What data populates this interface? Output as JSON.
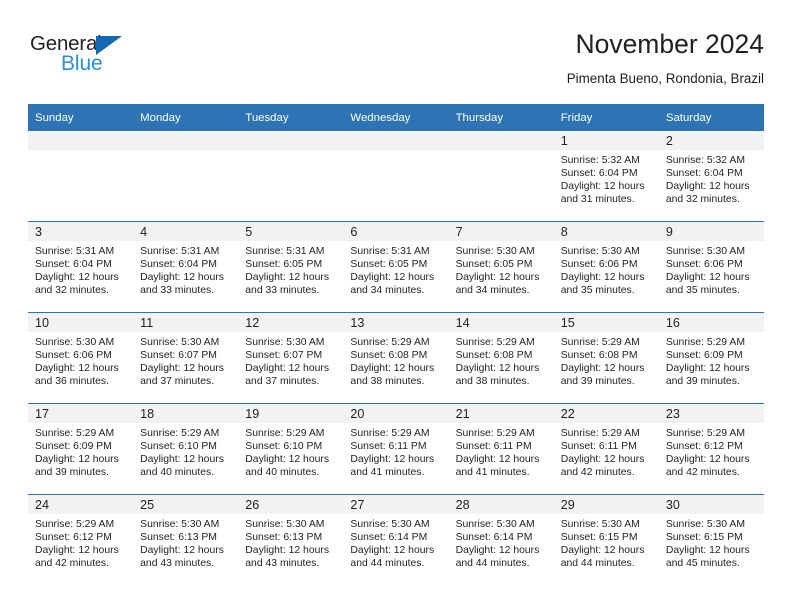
{
  "brand": {
    "name_part1": "General",
    "name_part2": "Blue",
    "triangle_color": "#1268b3",
    "blue_color": "#2b8fd8"
  },
  "header": {
    "title": "November 2024",
    "subtitle": "Pimenta Bueno, Rondonia, Brazil"
  },
  "theme": {
    "header_blue": "#2e74b5",
    "daystrip_gray": "#f2f2f2",
    "text": "#231f20"
  },
  "calendar": {
    "weekday_headers": [
      "Sunday",
      "Monday",
      "Tuesday",
      "Wednesday",
      "Thursday",
      "Friday",
      "Saturday"
    ],
    "weeks": [
      [
        {
          "day": "",
          "empty": true
        },
        {
          "day": "",
          "empty": true
        },
        {
          "day": "",
          "empty": true
        },
        {
          "day": "",
          "empty": true
        },
        {
          "day": "",
          "empty": true
        },
        {
          "day": "1",
          "sunrise": "Sunrise: 5:32 AM",
          "sunset": "Sunset: 6:04 PM",
          "daylight_1": "Daylight: 12 hours",
          "daylight_2": "and 31 minutes."
        },
        {
          "day": "2",
          "sunrise": "Sunrise: 5:32 AM",
          "sunset": "Sunset: 6:04 PM",
          "daylight_1": "Daylight: 12 hours",
          "daylight_2": "and 32 minutes."
        }
      ],
      [
        {
          "day": "3",
          "sunrise": "Sunrise: 5:31 AM",
          "sunset": "Sunset: 6:04 PM",
          "daylight_1": "Daylight: 12 hours",
          "daylight_2": "and 32 minutes."
        },
        {
          "day": "4",
          "sunrise": "Sunrise: 5:31 AM",
          "sunset": "Sunset: 6:04 PM",
          "daylight_1": "Daylight: 12 hours",
          "daylight_2": "and 33 minutes."
        },
        {
          "day": "5",
          "sunrise": "Sunrise: 5:31 AM",
          "sunset": "Sunset: 6:05 PM",
          "daylight_1": "Daylight: 12 hours",
          "daylight_2": "and 33 minutes."
        },
        {
          "day": "6",
          "sunrise": "Sunrise: 5:31 AM",
          "sunset": "Sunset: 6:05 PM",
          "daylight_1": "Daylight: 12 hours",
          "daylight_2": "and 34 minutes."
        },
        {
          "day": "7",
          "sunrise": "Sunrise: 5:30 AM",
          "sunset": "Sunset: 6:05 PM",
          "daylight_1": "Daylight: 12 hours",
          "daylight_2": "and 34 minutes."
        },
        {
          "day": "8",
          "sunrise": "Sunrise: 5:30 AM",
          "sunset": "Sunset: 6:06 PM",
          "daylight_1": "Daylight: 12 hours",
          "daylight_2": "and 35 minutes."
        },
        {
          "day": "9",
          "sunrise": "Sunrise: 5:30 AM",
          "sunset": "Sunset: 6:06 PM",
          "daylight_1": "Daylight: 12 hours",
          "daylight_2": "and 35 minutes."
        }
      ],
      [
        {
          "day": "10",
          "sunrise": "Sunrise: 5:30 AM",
          "sunset": "Sunset: 6:06 PM",
          "daylight_1": "Daylight: 12 hours",
          "daylight_2": "and 36 minutes."
        },
        {
          "day": "11",
          "sunrise": "Sunrise: 5:30 AM",
          "sunset": "Sunset: 6:07 PM",
          "daylight_1": "Daylight: 12 hours",
          "daylight_2": "and 37 minutes."
        },
        {
          "day": "12",
          "sunrise": "Sunrise: 5:30 AM",
          "sunset": "Sunset: 6:07 PM",
          "daylight_1": "Daylight: 12 hours",
          "daylight_2": "and 37 minutes."
        },
        {
          "day": "13",
          "sunrise": "Sunrise: 5:29 AM",
          "sunset": "Sunset: 6:08 PM",
          "daylight_1": "Daylight: 12 hours",
          "daylight_2": "and 38 minutes."
        },
        {
          "day": "14",
          "sunrise": "Sunrise: 5:29 AM",
          "sunset": "Sunset: 6:08 PM",
          "daylight_1": "Daylight: 12 hours",
          "daylight_2": "and 38 minutes."
        },
        {
          "day": "15",
          "sunrise": "Sunrise: 5:29 AM",
          "sunset": "Sunset: 6:08 PM",
          "daylight_1": "Daylight: 12 hours",
          "daylight_2": "and 39 minutes."
        },
        {
          "day": "16",
          "sunrise": "Sunrise: 5:29 AM",
          "sunset": "Sunset: 6:09 PM",
          "daylight_1": "Daylight: 12 hours",
          "daylight_2": "and 39 minutes."
        }
      ],
      [
        {
          "day": "17",
          "sunrise": "Sunrise: 5:29 AM",
          "sunset": "Sunset: 6:09 PM",
          "daylight_1": "Daylight: 12 hours",
          "daylight_2": "and 39 minutes."
        },
        {
          "day": "18",
          "sunrise": "Sunrise: 5:29 AM",
          "sunset": "Sunset: 6:10 PM",
          "daylight_1": "Daylight: 12 hours",
          "daylight_2": "and 40 minutes."
        },
        {
          "day": "19",
          "sunrise": "Sunrise: 5:29 AM",
          "sunset": "Sunset: 6:10 PM",
          "daylight_1": "Daylight: 12 hours",
          "daylight_2": "and 40 minutes."
        },
        {
          "day": "20",
          "sunrise": "Sunrise: 5:29 AM",
          "sunset": "Sunset: 6:11 PM",
          "daylight_1": "Daylight: 12 hours",
          "daylight_2": "and 41 minutes."
        },
        {
          "day": "21",
          "sunrise": "Sunrise: 5:29 AM",
          "sunset": "Sunset: 6:11 PM",
          "daylight_1": "Daylight: 12 hours",
          "daylight_2": "and 41 minutes."
        },
        {
          "day": "22",
          "sunrise": "Sunrise: 5:29 AM",
          "sunset": "Sunset: 6:11 PM",
          "daylight_1": "Daylight: 12 hours",
          "daylight_2": "and 42 minutes."
        },
        {
          "day": "23",
          "sunrise": "Sunrise: 5:29 AM",
          "sunset": "Sunset: 6:12 PM",
          "daylight_1": "Daylight: 12 hours",
          "daylight_2": "and 42 minutes."
        }
      ],
      [
        {
          "day": "24",
          "sunrise": "Sunrise: 5:29 AM",
          "sunset": "Sunset: 6:12 PM",
          "daylight_1": "Daylight: 12 hours",
          "daylight_2": "and 42 minutes."
        },
        {
          "day": "25",
          "sunrise": "Sunrise: 5:30 AM",
          "sunset": "Sunset: 6:13 PM",
          "daylight_1": "Daylight: 12 hours",
          "daylight_2": "and 43 minutes."
        },
        {
          "day": "26",
          "sunrise": "Sunrise: 5:30 AM",
          "sunset": "Sunset: 6:13 PM",
          "daylight_1": "Daylight: 12 hours",
          "daylight_2": "and 43 minutes."
        },
        {
          "day": "27",
          "sunrise": "Sunrise: 5:30 AM",
          "sunset": "Sunset: 6:14 PM",
          "daylight_1": "Daylight: 12 hours",
          "daylight_2": "and 44 minutes."
        },
        {
          "day": "28",
          "sunrise": "Sunrise: 5:30 AM",
          "sunset": "Sunset: 6:14 PM",
          "daylight_1": "Daylight: 12 hours",
          "daylight_2": "and 44 minutes."
        },
        {
          "day": "29",
          "sunrise": "Sunrise: 5:30 AM",
          "sunset": "Sunset: 6:15 PM",
          "daylight_1": "Daylight: 12 hours",
          "daylight_2": "and 44 minutes."
        },
        {
          "day": "30",
          "sunrise": "Sunrise: 5:30 AM",
          "sunset": "Sunset: 6:15 PM",
          "daylight_1": "Daylight: 12 hours",
          "daylight_2": "and 45 minutes."
        }
      ]
    ]
  }
}
